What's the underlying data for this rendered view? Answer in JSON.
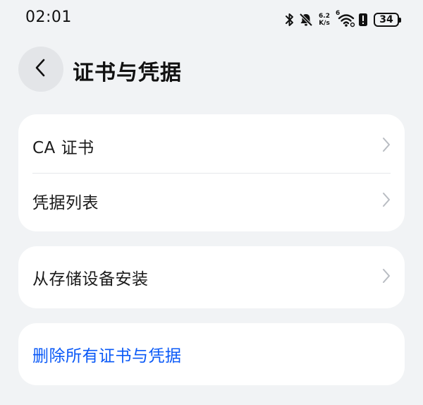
{
  "status_bar": {
    "time": "02:01",
    "net_speed_value": "6.2",
    "net_speed_unit": "K/s",
    "wifi_superscript": "6",
    "battery_level": "34",
    "icons": [
      "bluetooth-icon",
      "bell-off-icon",
      "wifi-icon",
      "battery-alert-icon",
      "battery-icon"
    ]
  },
  "header": {
    "title": "证书与凭据",
    "back_icon": "chevron-left-icon"
  },
  "groups": [
    {
      "items": [
        {
          "label": "CA 证书",
          "icon": "chevron-right-icon"
        },
        {
          "label": "凭据列表",
          "icon": "chevron-right-icon"
        }
      ]
    },
    {
      "items": [
        {
          "label": "从存储设备安装",
          "icon": "chevron-right-icon"
        }
      ]
    },
    {
      "items": [
        {
          "label": "删除所有证书与凭据"
        }
      ]
    }
  ],
  "colors": {
    "background": "#f1f3f5",
    "card": "#ffffff",
    "link": "#0a59f7",
    "chevron": "#b8bcc2"
  }
}
